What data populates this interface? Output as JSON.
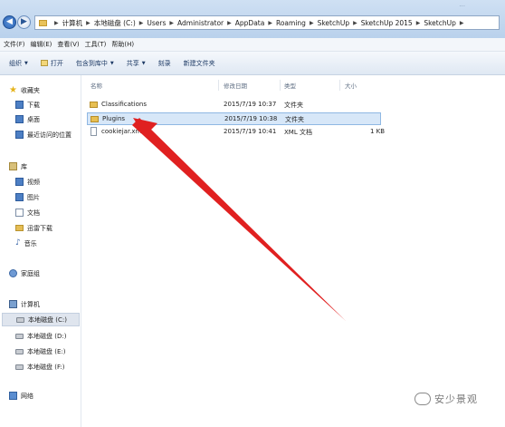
{
  "window": {
    "faded_title": "..."
  },
  "address_bar": {
    "crumbs": [
      "计算机",
      "本地磁盘 (C:)",
      "Users",
      "Administrator",
      "AppData",
      "Roaming",
      "SketchUp",
      "SketchUp 2015",
      "SketchUp"
    ]
  },
  "menu": [
    "文件(F)",
    "编辑(E)",
    "查看(V)",
    "工具(T)",
    "帮助(H)"
  ],
  "toolbar": {
    "organize": "组织",
    "open": "打开",
    "include_in_library": "包含到库中",
    "share": "共享",
    "burn": "刻录",
    "new_folder": "新建文件夹"
  },
  "sidebar": {
    "favorites": "收藏夹",
    "downloads": "下载",
    "desktop": "桌面",
    "recent": "最近访问的位置",
    "libraries": "库",
    "videos": "视频",
    "pictures": "图片",
    "documents": "文档",
    "thunder": "迅雷下载",
    "music": "音乐",
    "homegroup": "家庭组",
    "computer": "计算机",
    "drive_c": "本地磁盘 (C:)",
    "drive_d": "本地磁盘 (D:)",
    "drive_e": "本地磁盘 (E:)",
    "drive_f": "本地磁盘 (F:)",
    "network": "网络"
  },
  "columns": {
    "name": "名称",
    "date": "修改日期",
    "type": "类型",
    "size": "大小"
  },
  "files": [
    {
      "name": "Classifications",
      "date": "2015/7/19 10:37",
      "type": "文件夹",
      "size": "",
      "icon": "folder-icon",
      "selected": false
    },
    {
      "name": "Plugins",
      "date": "2015/7/19 10:38",
      "type": "文件夹",
      "size": "",
      "icon": "folder-icon",
      "selected": true
    },
    {
      "name": "cookiejar.xml",
      "date": "2015/7/19 10:41",
      "type": "XML 文档",
      "size": "1 KB",
      "icon": "xml-file-icon",
      "selected": false
    }
  ],
  "annotation": {
    "color": "#e02020"
  },
  "watermark": "安少景观"
}
